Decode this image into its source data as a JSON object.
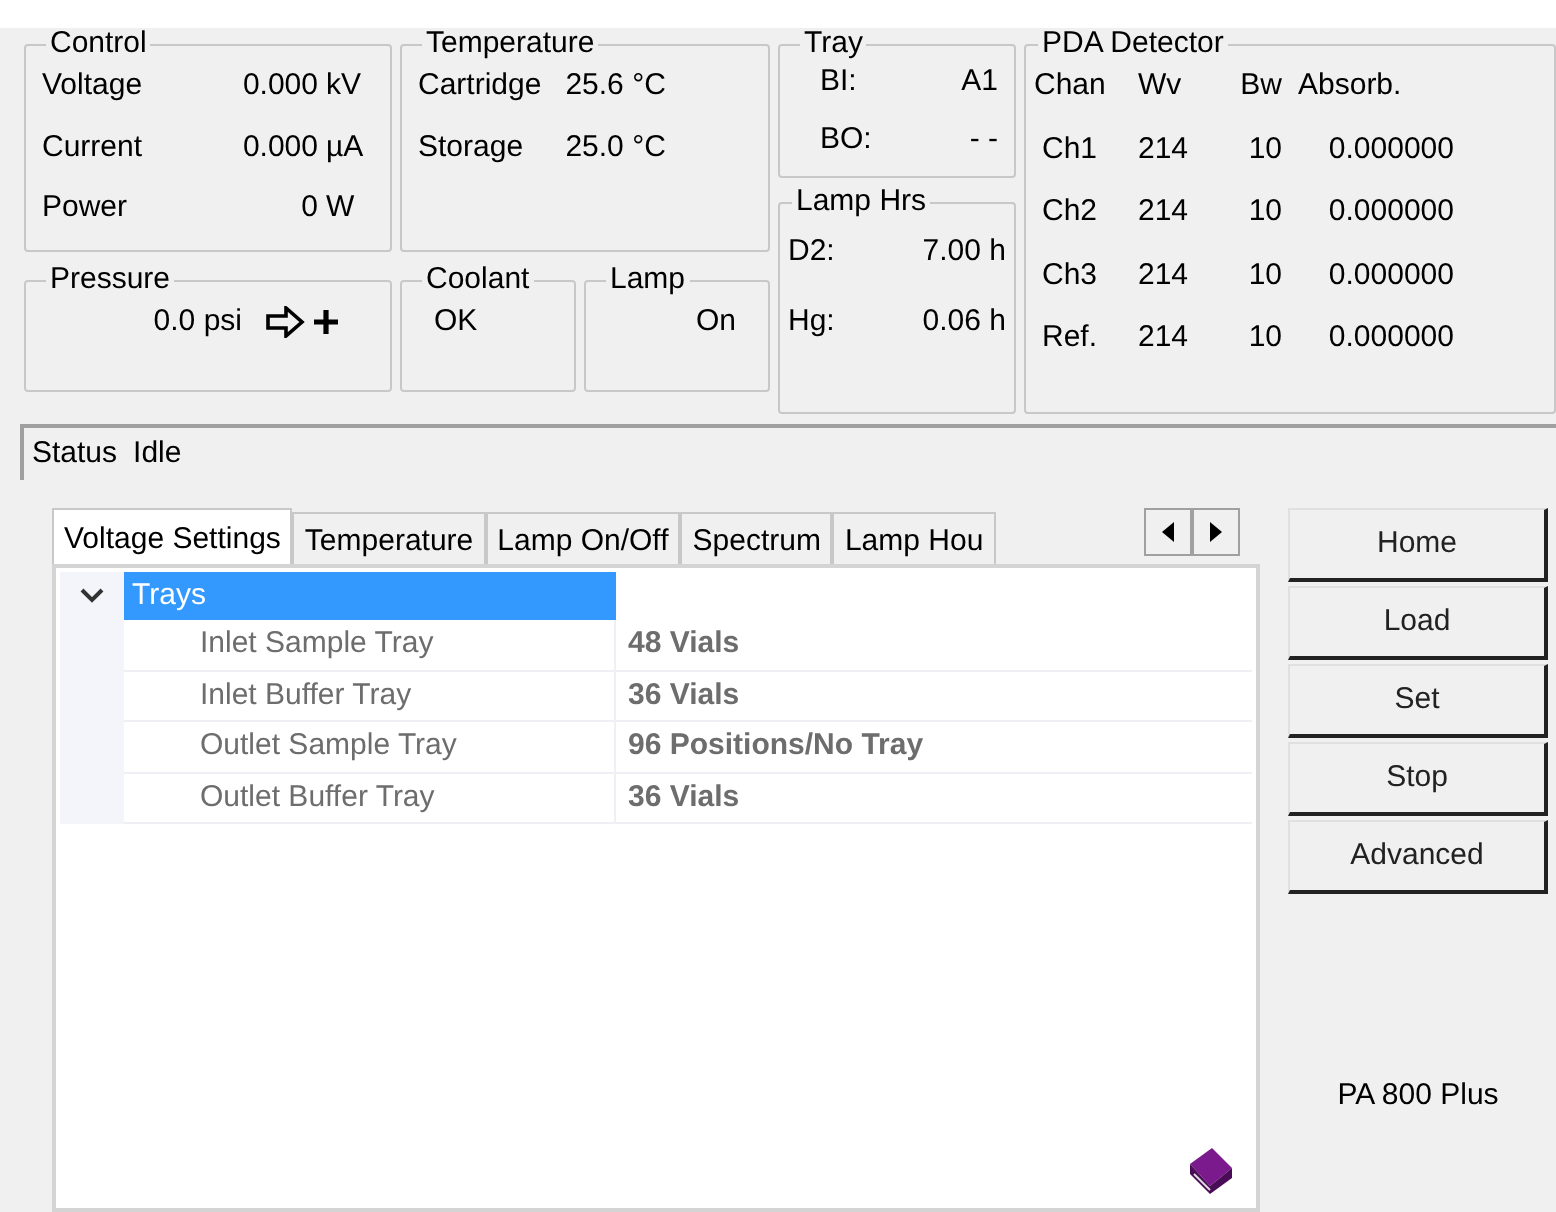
{
  "control": {
    "title": "Control",
    "rows": [
      {
        "label": "Voltage",
        "value": "0.000",
        "unit": "kV"
      },
      {
        "label": "Current",
        "value": "0.000",
        "unit": "µA"
      },
      {
        "label": "Power",
        "value": "0",
        "unit": "W"
      }
    ]
  },
  "temperature": {
    "title": "Temperature",
    "rows": [
      {
        "label": "Cartridge",
        "value": "25.6 °C"
      },
      {
        "label": "Storage",
        "value": "25.0 °C"
      }
    ]
  },
  "tray": {
    "title": "Tray",
    "rows": [
      {
        "label": "BI:",
        "value": "A1"
      },
      {
        "label": "BO:",
        "value": "- -"
      }
    ]
  },
  "lamp_hrs": {
    "title": "Lamp Hrs",
    "rows": [
      {
        "label": "D2:",
        "value": "7.00 h"
      },
      {
        "label": "Hg:",
        "value": "0.06 h"
      }
    ]
  },
  "pda": {
    "title": "PDA Detector",
    "columns": [
      "Chan",
      "Wv",
      "Bw",
      "Absorb."
    ],
    "rows": [
      [
        "Ch1",
        "214",
        "10",
        "0.000000"
      ],
      [
        "Ch2",
        "214",
        "10",
        "0.000000"
      ],
      [
        "Ch3",
        "214",
        "10",
        "0.000000"
      ],
      [
        "Ref.",
        "214",
        "10",
        "0.000000"
      ]
    ]
  },
  "pressure": {
    "title": "Pressure",
    "value": "0.0 psi"
  },
  "coolant": {
    "title": "Coolant",
    "value": "OK"
  },
  "lamp": {
    "title": "Lamp",
    "value": "On"
  },
  "status": {
    "label": "Status",
    "value": "Idle"
  },
  "tabs": [
    {
      "label": "Voltage Settings",
      "selected": true
    },
    {
      "label": "Temperature",
      "selected": false
    },
    {
      "label": "Lamp On/Off",
      "selected": false
    },
    {
      "label": "Spectrum",
      "selected": false
    },
    {
      "label": "Lamp Hou",
      "selected": false
    }
  ],
  "tree": [
    {
      "label": "Trays",
      "expanded": true,
      "selected": true,
      "children": [
        {
          "label": "Inlet Sample Tray",
          "value": "48 Vials"
        },
        {
          "label": "Inlet Buffer Tray",
          "value": "36 Vials"
        },
        {
          "label": "Outlet Sample Tray",
          "value": "96 Positions/No Tray"
        },
        {
          "label": "Outlet Buffer Tray",
          "value": "36 Vials"
        }
      ]
    }
  ],
  "buttons": [
    "Home",
    "Load",
    "Set",
    "Stop",
    "Advanced"
  ],
  "instrument": "PA 800 Plus"
}
